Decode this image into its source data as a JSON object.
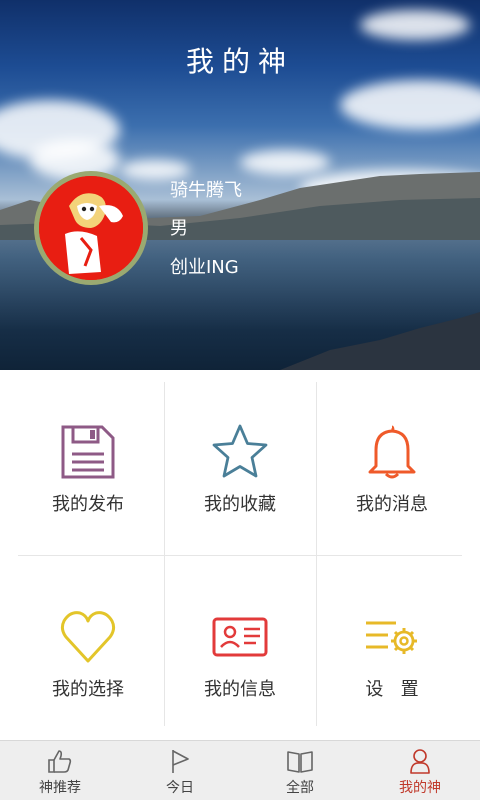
{
  "header": {
    "title": "我的神"
  },
  "profile": {
    "name": "骑牛腾飞",
    "gender": "男",
    "status": "创业ING"
  },
  "menu": {
    "items": [
      {
        "label": "我的发布",
        "icon": "floppy-disk-icon",
        "color": "#8e5a86"
      },
      {
        "label": "我的收藏",
        "icon": "star-icon",
        "color": "#4a7f98"
      },
      {
        "label": "我的消息",
        "icon": "bell-icon",
        "color": "#ef5a2a"
      },
      {
        "label": "我的选择",
        "icon": "heart-icon",
        "color": "#e3c52a"
      },
      {
        "label": "我的信息",
        "icon": "id-card-icon",
        "color": "#e23a3a"
      },
      {
        "label": "设   置",
        "icon": "settings-gear-icon",
        "color": "#e7b928"
      }
    ]
  },
  "tabbar": {
    "tabs": [
      {
        "label": "神推荐",
        "icon": "thumbs-up-icon",
        "active": false
      },
      {
        "label": "今日",
        "icon": "flag-icon",
        "active": false
      },
      {
        "label": "全部",
        "icon": "open-book-icon",
        "active": false
      },
      {
        "label": "我的神",
        "icon": "person-icon",
        "active": true
      }
    ],
    "active_color": "#c0392b"
  }
}
